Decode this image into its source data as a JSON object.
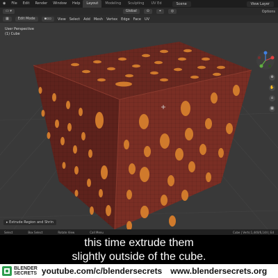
{
  "topbar": {
    "menus": [
      "File",
      "Edit",
      "Render",
      "Window",
      "Help"
    ],
    "workspaces": [
      "Layout",
      "Modeling",
      "Sculpting",
      "UV Ed"
    ],
    "active_workspace": "Layout",
    "scene": "Scene",
    "view_layer": "View Layer"
  },
  "header2": {
    "orientation": "Global",
    "options": "Options"
  },
  "header3": {
    "mode": "Edit Mode",
    "menus": [
      "View",
      "Select",
      "Add",
      "Mesh",
      "Vertex",
      "Edge",
      "Face",
      "UV"
    ]
  },
  "viewport": {
    "perspective": "User Perspective",
    "object": "(1) Cube",
    "bg_color": "#393939",
    "cube_color": "#7a2e24",
    "dot_color": "#d07a2c"
  },
  "last_operator": "Extrude Region and Shrin",
  "statusbar": {
    "select": "Select",
    "box_select": "Box Select",
    "rotate_view": "Rotate View",
    "call_menu": "Call Menu",
    "stats": "Cube | Verts:1,440/6,144 | Ed"
  },
  "caption": {
    "line1": "this time extrude them",
    "line2": "slightly outside of the cube."
  },
  "footer": {
    "brand_line1": "BLENDER",
    "brand_line2": "SECRETS",
    "youtube": "youtube.com/c/blendersecrets",
    "website": "www.blendersecrets.org",
    "brand_color": "#2e9e4f"
  }
}
